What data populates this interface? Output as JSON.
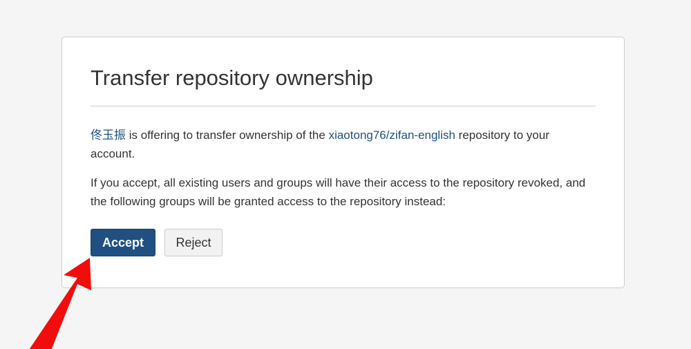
{
  "dialog": {
    "title": "Transfer repository ownership",
    "offer": {
      "user_link": "佟玉振",
      "text_before_repo": " is offering to transfer ownership of the ",
      "repo_link": "xiaotong76/zifan-english",
      "text_after_repo": " repository to your account."
    },
    "consequence_text": "If you accept, all existing users and groups will have their access to the repository revoked, and the following groups will be granted access to the repository instead:",
    "accept_label": "Accept",
    "reject_label": "Reject"
  },
  "colors": {
    "page_background": "#f5f5f5",
    "link": "#205081",
    "primary_button": "#205081",
    "annotation_arrow": "#f20d0d"
  }
}
